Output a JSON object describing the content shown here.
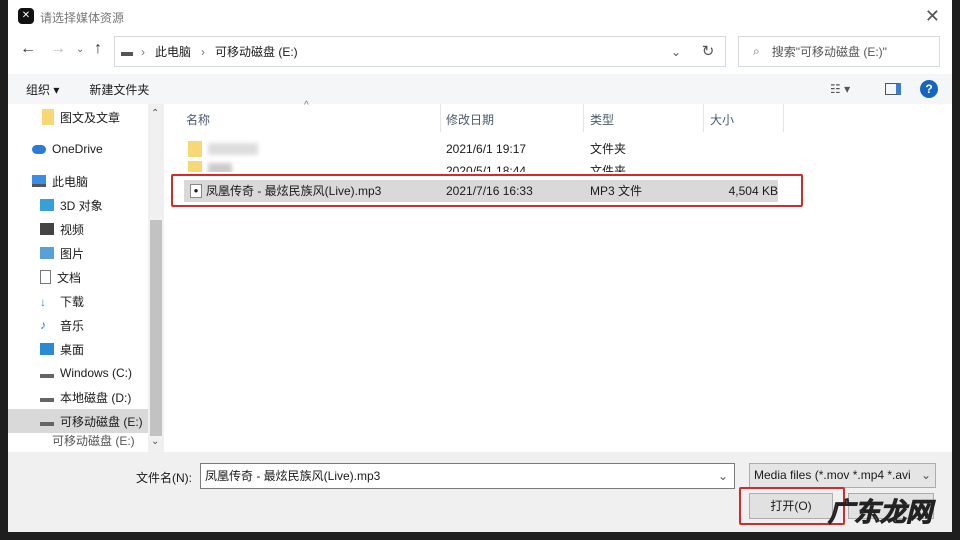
{
  "title": "请选择媒体资源",
  "app_logo": "剪",
  "address": {
    "root": "此电脑",
    "current": "可移动磁盘 (E:)"
  },
  "search": {
    "placeholder": "搜索\"可移动磁盘 (E:)\""
  },
  "toolbar": {
    "organize": "组织 ▾",
    "new_folder": "新建文件夹"
  },
  "sidebar": {
    "items": [
      {
        "label": "图文及文章",
        "icon": "folder-icon"
      },
      {
        "label": "OneDrive",
        "icon": "cloud-icon"
      },
      {
        "label": "此电脑",
        "icon": "computer-icon"
      },
      {
        "label": "3D 对象",
        "icon": "cube-icon"
      },
      {
        "label": "视频",
        "icon": "video-icon"
      },
      {
        "label": "图片",
        "icon": "picture-icon"
      },
      {
        "label": "文档",
        "icon": "document-icon"
      },
      {
        "label": "下载",
        "icon": "download-icon"
      },
      {
        "label": "音乐",
        "icon": "music-icon"
      },
      {
        "label": "桌面",
        "icon": "desktop-icon"
      },
      {
        "label": "Windows (C:)",
        "icon": "drive-icon"
      },
      {
        "label": "本地磁盘 (D:)",
        "icon": "drive-icon"
      },
      {
        "label": "可移动磁盘 (E:)",
        "icon": "drive-icon"
      },
      {
        "label": "可移动磁盘 (E:)",
        "icon": "drive-icon"
      }
    ]
  },
  "columns": {
    "name": "名称",
    "date": "修改日期",
    "type": "类型",
    "size": "大小"
  },
  "files": [
    {
      "name": "",
      "date": "2021/6/1 19:17",
      "type": "文件夹",
      "size": ""
    },
    {
      "name": "",
      "date": "2020/5/1 18:44",
      "type": "文件夹",
      "size": ""
    },
    {
      "name": "凤凰传奇 - 最炫民族风(Live).mp3",
      "date": "2021/7/16 16:33",
      "type": "MP3 文件",
      "size": "4,504 KB"
    }
  ],
  "bottom": {
    "filename_label": "文件名(N):",
    "filename_value": "凤凰传奇 - 最炫民族风(Live).mp3",
    "filetype": "Media files (*.mov *.mp4 *.avi",
    "open": "打开(O)",
    "cancel": "取消"
  },
  "watermark": "广东龙网",
  "colors": {
    "highlight": "#d9282a",
    "selected_row": "#d9d9d9"
  }
}
